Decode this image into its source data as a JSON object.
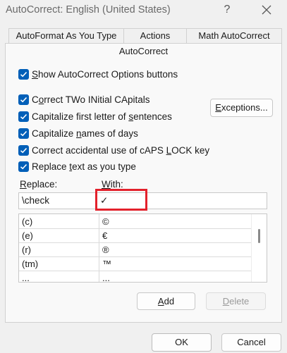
{
  "window": {
    "title": "AutoCorrect: English (United States)",
    "help_label": "?"
  },
  "tabs": [
    {
      "label": "AutoFormat As You Type"
    },
    {
      "label": "Actions"
    },
    {
      "label": "Math AutoCorrect"
    }
  ],
  "selected_tab": {
    "label": "AutoCorrect"
  },
  "options": {
    "show_buttons": {
      "prefix": "",
      "accel": "S",
      "rest": "how AutoCorrect Options buttons",
      "checked": true
    },
    "two_initial": {
      "prefix": "C",
      "accel": "o",
      "rest": "rrect TWo INitial CApitals",
      "checked": true
    },
    "first_letter": {
      "prefix": "Capitalize first letter of ",
      "accel": "s",
      "rest": "entences",
      "checked": true
    },
    "names_of_days": {
      "prefix": "Capitalize ",
      "accel": "n",
      "rest": "ames of days",
      "checked": true
    },
    "caps_lock": {
      "prefix": "Correct accidental use of cAPS ",
      "accel": "L",
      "rest": "OCK key",
      "checked": true
    },
    "replace_text": {
      "prefix": "Replace ",
      "accel": "t",
      "rest": "ext as you type",
      "checked": true
    }
  },
  "exceptions_button": {
    "accel": "E",
    "rest": "xceptions..."
  },
  "replace_label": {
    "accel": "R",
    "rest": "eplace:"
  },
  "with_label": {
    "accel": "W",
    "rest": "ith:"
  },
  "replace_value": "\\check",
  "with_value": "✓",
  "entries": [
    {
      "replace": "(c)",
      "with": "©"
    },
    {
      "replace": "(e)",
      "with": "€"
    },
    {
      "replace": "(r)",
      "with": "®"
    },
    {
      "replace": "(tm)",
      "with": "™"
    },
    {
      "replace": "...",
      "with": "..."
    }
  ],
  "add_button": {
    "accel": "A",
    "rest": "dd"
  },
  "delete_button": {
    "accel": "D",
    "rest": "elete"
  },
  "ok_button": "OK",
  "cancel_button": "Cancel",
  "icons": {
    "close": "close-icon",
    "check": "checkmark-icon"
  },
  "colors": {
    "accent": "#005fb8",
    "highlight": "#e3212c"
  }
}
